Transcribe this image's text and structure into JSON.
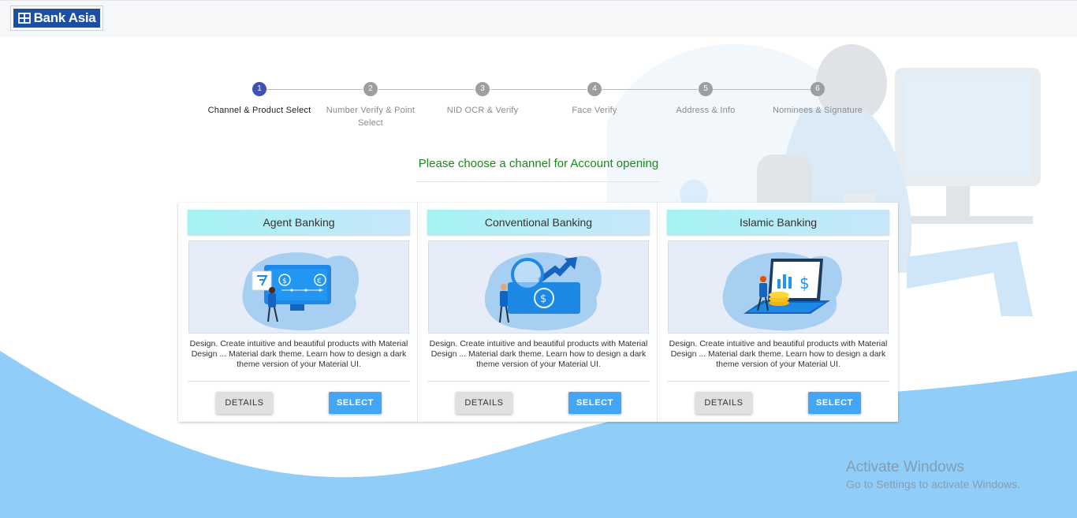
{
  "header": {
    "brand": "Bank Asia"
  },
  "stepper": {
    "steps": [
      {
        "number": "1",
        "label": "Channel & Product Select",
        "active": true
      },
      {
        "number": "2",
        "label": "Number Verify & Point Select",
        "active": false
      },
      {
        "number": "3",
        "label": "NID OCR & Verify",
        "active": false
      },
      {
        "number": "4",
        "label": "Face Verify",
        "active": false
      },
      {
        "number": "5",
        "label": "Address & Info",
        "active": false
      },
      {
        "number": "6",
        "label": "Nominees & Signature",
        "active": false
      }
    ]
  },
  "main": {
    "heading": "Please choose a channel for Account opening"
  },
  "cards": [
    {
      "title": "Agent Banking",
      "illustration": "agent-banking-illustration",
      "description": "Design. Create intuitive and beautiful products with Material Design ... Material dark theme. Learn how to design a dark theme version of your Material UI.",
      "details_label": "DETAILS",
      "select_label": "SELECT"
    },
    {
      "title": "Conventional Banking",
      "illustration": "conventional-banking-illustration",
      "description": "Design. Create intuitive and beautiful products with Material Design ... Material dark theme. Learn how to design a dark theme version of your Material UI.",
      "details_label": "DETAILS",
      "select_label": "SELECT"
    },
    {
      "title": "Islamic Banking",
      "illustration": "islamic-banking-illustration",
      "description": "Design. Create intuitive and beautiful products with Material Design ... Material dark theme. Learn how to design a dark theme version of your Material UI.",
      "details_label": "DETAILS",
      "select_label": "SELECT"
    }
  ],
  "watermark": {
    "title": "Activate Windows",
    "subtitle": "Go to Settings to activate Windows."
  },
  "colors": {
    "brand": "#1c4ea1",
    "stepper_active": "#3f51b5",
    "heading": "#1a8a1a",
    "select_button": "#42a5f5",
    "wave": "#90cdf9"
  }
}
